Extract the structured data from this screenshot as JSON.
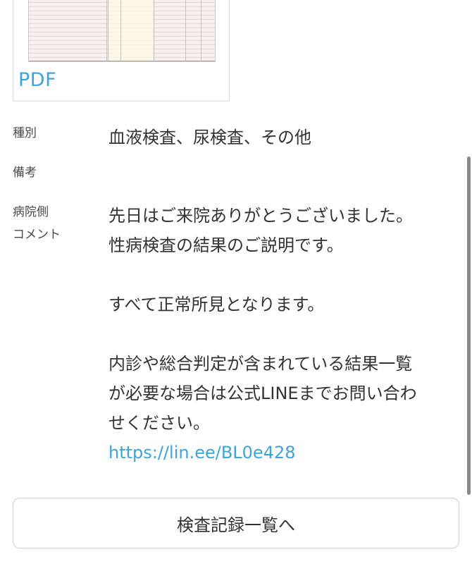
{
  "attachment": {
    "link_text": "PDF"
  },
  "details": {
    "type_label": "種別",
    "type_value": "血液検査、尿検査、その他",
    "notes_label": "備考",
    "notes_value": "",
    "comment_label_line1": "病院側",
    "comment_label_line2": "コメント",
    "comment_line1": "先日はご来院ありがとうございました。",
    "comment_line2": "性病検査の結果のご説明です。",
    "comment_line3": "すべて正常所見となります。",
    "comment_line4": "内診や総合判定が含まれている結果一覧",
    "comment_line5": "が必要な場合は公式LINEまでお問い合わ",
    "comment_line6": "せください。",
    "comment_link": "https://lin.ee/BL0e428"
  },
  "footer": {
    "button_label": "検査記録一覧へ"
  },
  "colors": {
    "link": "#3fa3d6",
    "text": "#333333",
    "border": "#d0d0d0"
  }
}
